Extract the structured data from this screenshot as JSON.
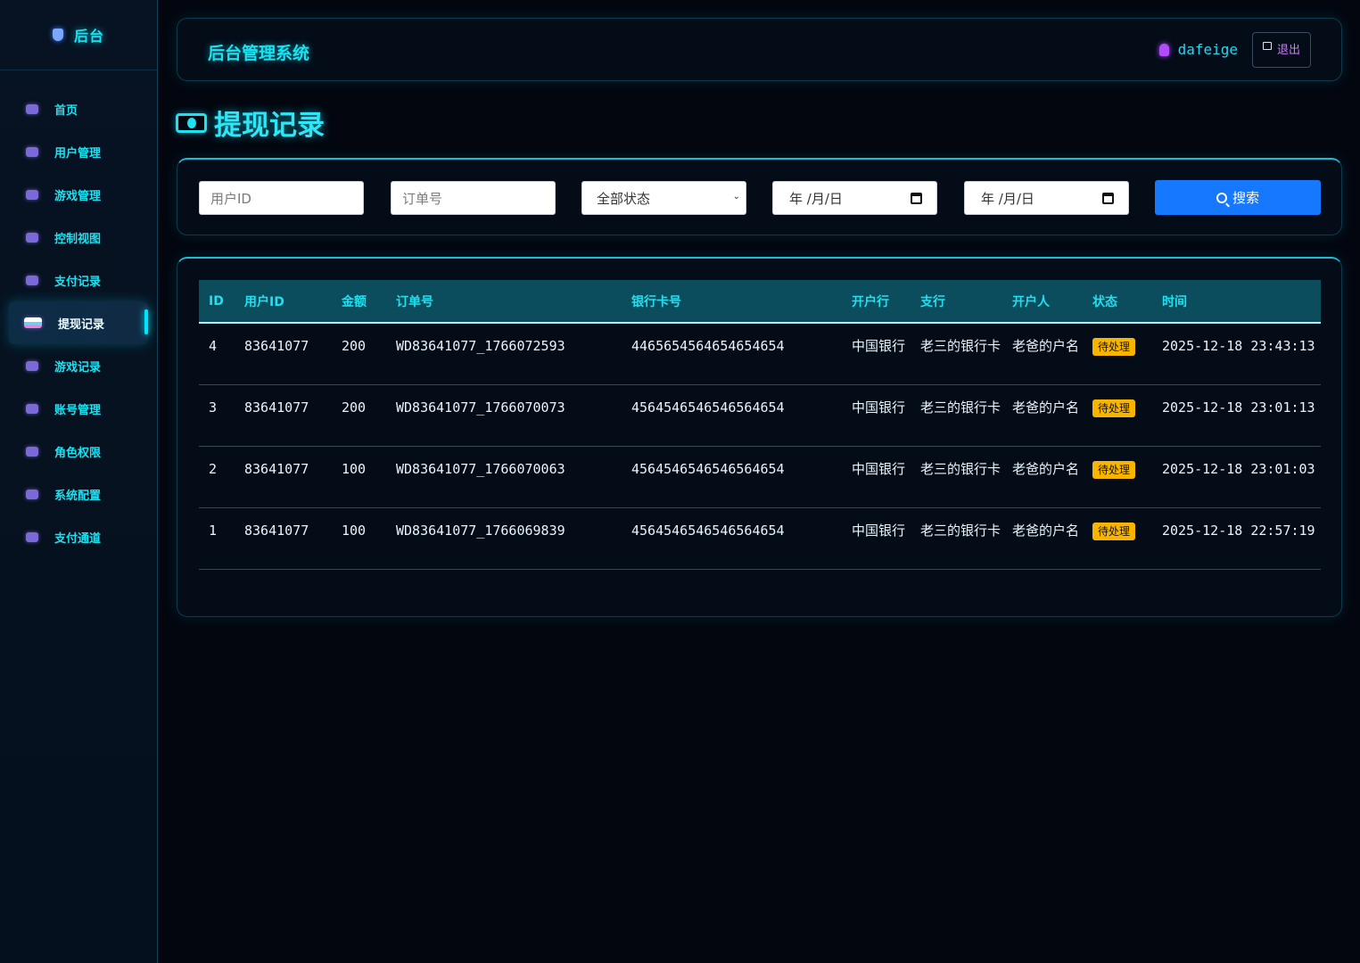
{
  "brand": {
    "label": "后台"
  },
  "sidebar": {
    "items": [
      {
        "label": "首页",
        "icon": "home-icon"
      },
      {
        "label": "用户管理",
        "icon": "users-icon"
      },
      {
        "label": "游戏管理",
        "icon": "gamepad-icon"
      },
      {
        "label": "控制视图",
        "icon": "sliders-icon"
      },
      {
        "label": "支付记录",
        "icon": "money-icon"
      },
      {
        "label": "提现记录",
        "icon": "withdraw-icon",
        "active": true
      },
      {
        "label": "游戏记录",
        "icon": "list-icon"
      },
      {
        "label": "账号管理",
        "icon": "user-icon"
      },
      {
        "label": "角色权限",
        "icon": "shield-icon"
      },
      {
        "label": "系统配置",
        "icon": "gear-icon"
      },
      {
        "label": "支付通道",
        "icon": "channel-icon"
      }
    ]
  },
  "header": {
    "title": "后台管理系统",
    "username": "dafeige",
    "logout_label": "退出"
  },
  "page": {
    "title": "提现记录"
  },
  "filters": {
    "user_id_placeholder": "用户ID",
    "order_no_placeholder": "订单号",
    "status_selected": "全部状态",
    "start_date_placeholder": "年 /月/日",
    "end_date_placeholder": "年 /月/日",
    "search_label": "搜索"
  },
  "table": {
    "columns": [
      "ID",
      "用户ID",
      "金额",
      "订单号",
      "银行卡号",
      "开户行",
      "支行",
      "开户人",
      "状态",
      "时间"
    ],
    "rows": [
      {
        "id": "4",
        "user_id": "83641077",
        "amount": "200",
        "order_no": "WD83641077_1766072593",
        "card": "4465654564654654654",
        "bank": "中国银行",
        "branch": "老三的银行卡",
        "holder": "老爸的户名",
        "status": "待处理",
        "time": "2025-12-18 23:43:13"
      },
      {
        "id": "3",
        "user_id": "83641077",
        "amount": "200",
        "order_no": "WD83641077_1766070073",
        "card": "4564546546546564654",
        "bank": "中国银行",
        "branch": "老三的银行卡",
        "holder": "老爸的户名",
        "status": "待处理",
        "time": "2025-12-18 23:01:13"
      },
      {
        "id": "2",
        "user_id": "83641077",
        "amount": "100",
        "order_no": "WD83641077_1766070063",
        "card": "4564546546546564654",
        "bank": "中国银行",
        "branch": "老三的银行卡",
        "holder": "老爸的户名",
        "status": "待处理",
        "time": "2025-12-18 23:01:03"
      },
      {
        "id": "1",
        "user_id": "83641077",
        "amount": "100",
        "order_no": "WD83641077_1766069839",
        "card": "4564546546546564654",
        "bank": "中国银行",
        "branch": "老三的银行卡",
        "holder": "老爸的户名",
        "status": "待处理",
        "time": "2025-12-18 22:57:19"
      }
    ]
  },
  "colors": {
    "accent": "#19e3f0",
    "primary_button": "#1677ff",
    "badge": "#f7b500",
    "background": "#03060f"
  }
}
